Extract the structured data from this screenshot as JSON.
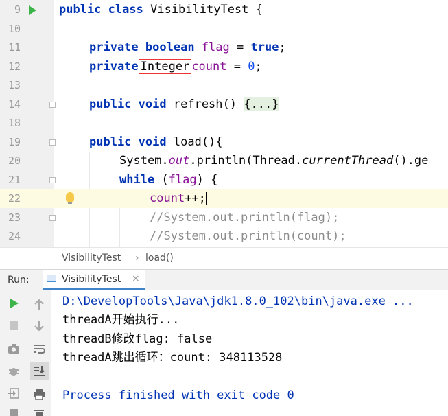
{
  "editor": {
    "lines": [
      {
        "num": "9"
      },
      {
        "num": "10"
      },
      {
        "num": "11"
      },
      {
        "num": "12"
      },
      {
        "num": "13"
      },
      {
        "num": "14"
      },
      {
        "num": "18"
      },
      {
        "num": "19"
      },
      {
        "num": "20"
      },
      {
        "num": "21"
      },
      {
        "num": "22"
      },
      {
        "num": "23"
      },
      {
        "num": "24"
      }
    ],
    "tokens": {
      "public": "public",
      "class": "class",
      "class_name": "VisibilityTest",
      "open_brace": " {",
      "private": "private",
      "boolean": "boolean",
      "flag": "flag",
      "eq": " = ",
      "true": "true",
      "semi": ";",
      "integer": "Integer",
      "count": "count",
      "zero": "0",
      "void": "void",
      "refresh": "refresh()",
      "folded": "{...}",
      "load": "load(){",
      "system": "System.",
      "out": "out",
      "println": ".println(Thread.",
      "current_thread": "currentThread",
      "ge": "().ge",
      "while": "while",
      "while_cond_open": " (",
      "while_cond_close": ") {",
      "count_inc": "count",
      "inc": "++;",
      "comment1": "//System.out.println(flag);",
      "comment2": "//System.out.println(count);"
    }
  },
  "breadcrumb": {
    "class": "VisibilityTest",
    "separator": "›",
    "method": "load()"
  },
  "run": {
    "label": "Run:",
    "tab_label": "VisibilityTest",
    "tab_close": "×"
  },
  "console": {
    "lines": [
      "D:\\DevelopTools\\Java\\jdk1.8.0_102\\bin\\java.exe ...",
      "threadA开始执行...",
      "threadB修改flag: false",
      "threadA跳出循环：count: 348113528",
      "",
      "Process finished with exit code 0"
    ]
  },
  "colors": {
    "keyword": "#0033b3",
    "field": "#871094",
    "number": "#1750eb",
    "comment": "#8c8c8c",
    "exit_message": "#0033b3",
    "command_line": "#0033b3",
    "run_green": "#3cb44a"
  },
  "icons": {
    "run_gutter": "run-arrow-icon",
    "bulb": "lightbulb-icon",
    "rerun": "play-icon",
    "stop": "stop-icon",
    "up": "arrow-up-icon",
    "down": "arrow-down-icon",
    "camera": "camera-icon",
    "wrap": "soft-wrap-icon",
    "scroll_end": "scroll-to-end-icon",
    "print": "print-icon",
    "settings": "gear-icon",
    "login": "import-icon",
    "trash": "trash-icon"
  }
}
